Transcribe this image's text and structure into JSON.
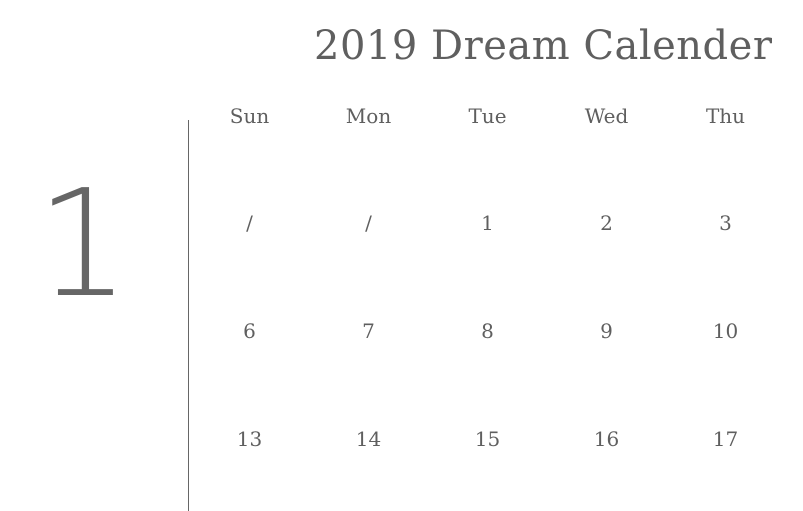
{
  "calendar": {
    "title": "2019 Dream Calender",
    "month": "1",
    "weekdays": [
      "Sun",
      "Mon",
      "Tue",
      "Wed",
      "Thu"
    ],
    "rows": [
      [
        "/",
        "/",
        "1",
        "2",
        "3"
      ],
      [
        "6",
        "7",
        "8",
        "9",
        "10"
      ],
      [
        "13",
        "14",
        "15",
        "16",
        "17"
      ]
    ]
  }
}
